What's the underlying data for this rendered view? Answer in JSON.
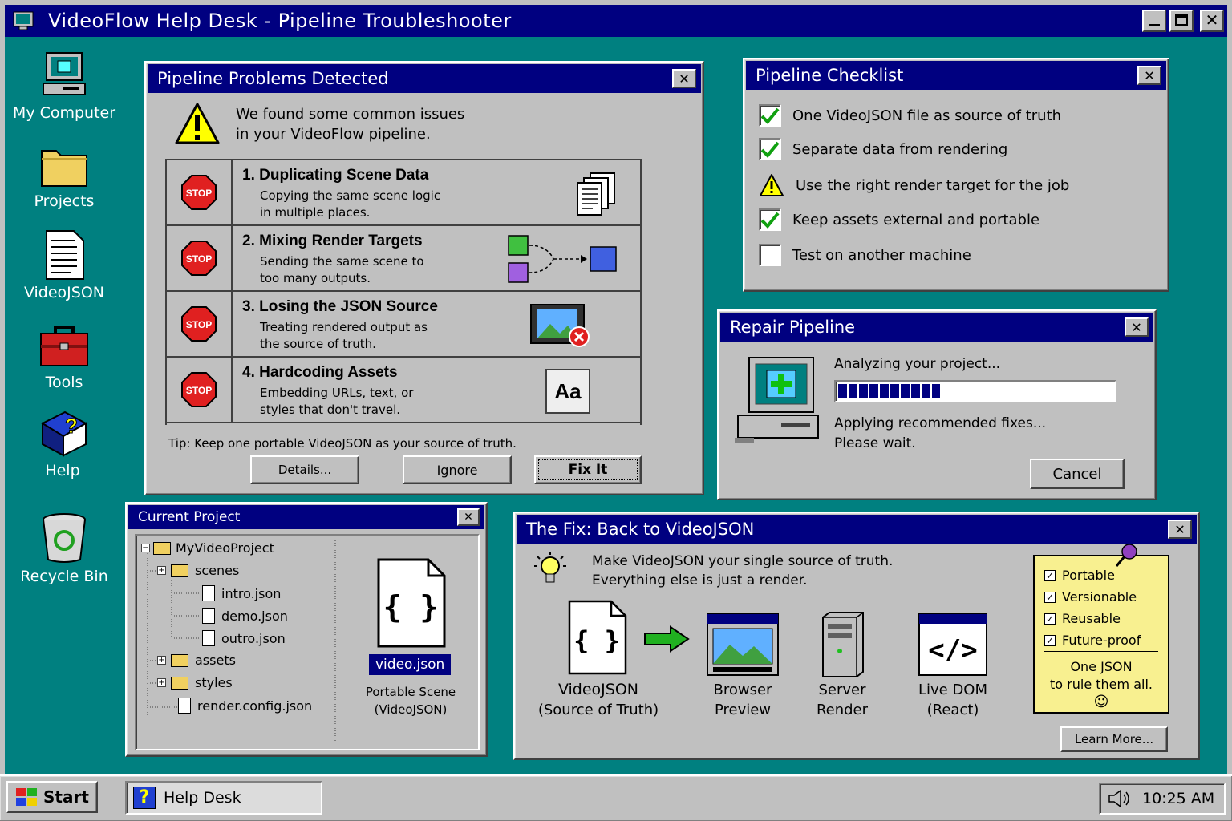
{
  "app": {
    "title": "VideoFlow Help Desk - Pipeline Troubleshooter"
  },
  "desktop": {
    "icons": [
      "My Computer",
      "Projects",
      "VideoJSON",
      "Tools",
      "Help",
      "Recycle Bin"
    ]
  },
  "problems": {
    "title": "Pipeline Problems Detected",
    "intro_line1": "We found some common issues",
    "intro_line2": "in your VideoFlow pipeline.",
    "items": [
      {
        "heading": "1. Duplicating Scene Data",
        "line1": "Copying the same scene logic",
        "line2": "in multiple places."
      },
      {
        "heading": "2. Mixing Render Targets",
        "line1": "Sending the same scene to",
        "line2": "too many outputs."
      },
      {
        "heading": "3. Losing the JSON Source",
        "line1": "Treating rendered output as",
        "line2": "the source of truth."
      },
      {
        "heading": "4. Hardcoding Assets",
        "line1": "Embedding URLs, text, or",
        "line2": "styles that don't travel."
      }
    ],
    "stop_label": "STOP",
    "font_icon_label": "Aa",
    "tip": "Tip: Keep one portable VideoJSON as your source of truth.",
    "buttons": {
      "details": "Details...",
      "ignore": "Ignore",
      "fix": "Fix It"
    }
  },
  "checklist": {
    "title": "Pipeline Checklist",
    "items": [
      {
        "label": "One VideoJSON file as source of truth",
        "state": "checked"
      },
      {
        "label": "Separate data from rendering",
        "state": "checked"
      },
      {
        "label": "Use the right render target for the job",
        "state": "warning"
      },
      {
        "label": "Keep assets external and portable",
        "state": "checked"
      },
      {
        "label": "Test on another machine",
        "state": "unchecked"
      }
    ]
  },
  "repair": {
    "title": "Repair Pipeline",
    "status": "Analyzing your project...",
    "progress": 0.37,
    "line1": "Applying recommended fixes...",
    "line2": "Please wait.",
    "cancel": "Cancel"
  },
  "project": {
    "title": "Current Project",
    "root": "MyVideoProject",
    "scenes": "scenes",
    "files": [
      "intro.json",
      "demo.json",
      "outro.json"
    ],
    "assets": "assets",
    "styles": "styles",
    "config": "render.config.json",
    "file_badge": "video.json",
    "braces": "{ }",
    "caption1": "Portable Scene",
    "caption2": "(VideoJSON)"
  },
  "fix": {
    "title": "The Fix: Back to VideoJSON",
    "line1": "Make VideoJSON your single source of truth.",
    "line2": "Everything else is just a render.",
    "braces": "{ }",
    "code_glyph": "</>",
    "flow": [
      {
        "l1": "VideoJSON",
        "l2": "(Source of Truth)"
      },
      {
        "l1": "Browser",
        "l2": "Preview"
      },
      {
        "l1": "Server",
        "l2": "Render"
      },
      {
        "l1": "Live DOM",
        "l2": "(React)"
      }
    ],
    "note": {
      "items": [
        "Portable",
        "Versionable",
        "Reusable",
        "Future-proof"
      ],
      "line1": "One JSON",
      "line2": "to rule them all.",
      "smiley": "☺"
    },
    "learn_more": "Learn More..."
  },
  "taskbar": {
    "start": "Start",
    "task": "Help Desk",
    "time": "10:25 AM"
  }
}
